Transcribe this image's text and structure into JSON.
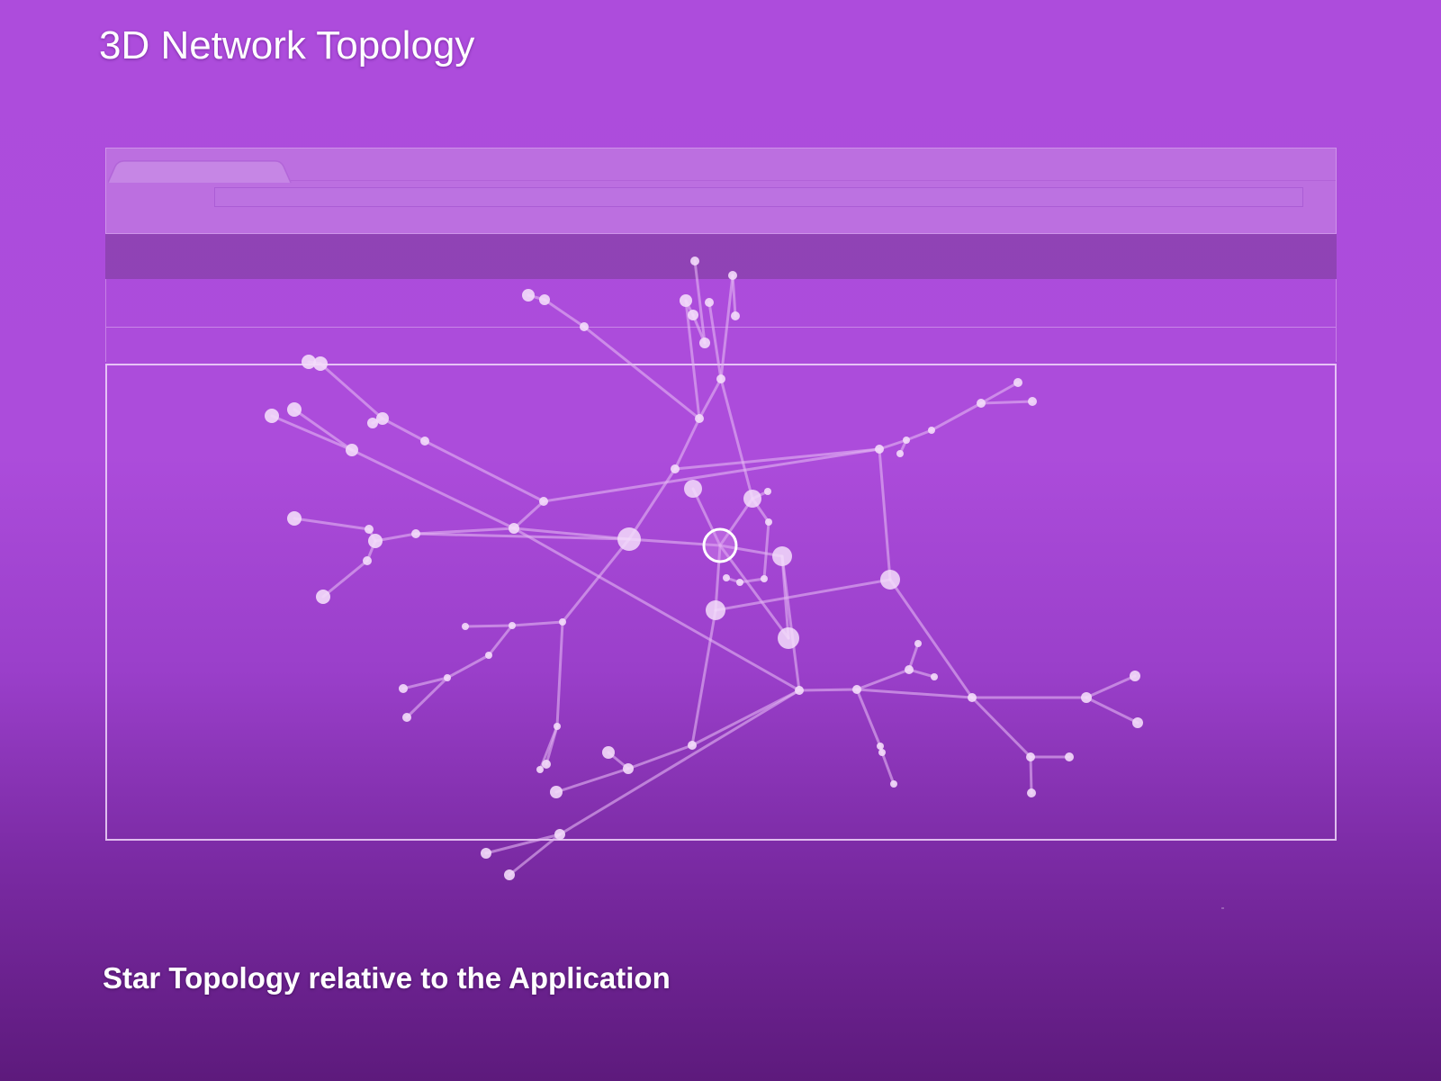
{
  "title": "3D Network Topology",
  "caption": "Star Topology relative to the Application",
  "colors": {
    "background_top": "#ad4cdc",
    "background_bottom": "#5d1a7c",
    "node": "#f3dcfa",
    "edge": "#e2b5f2",
    "selected_ring": "#ffffff"
  },
  "icons": {
    "selected_node": "selected-node-ring-icon"
  }
}
